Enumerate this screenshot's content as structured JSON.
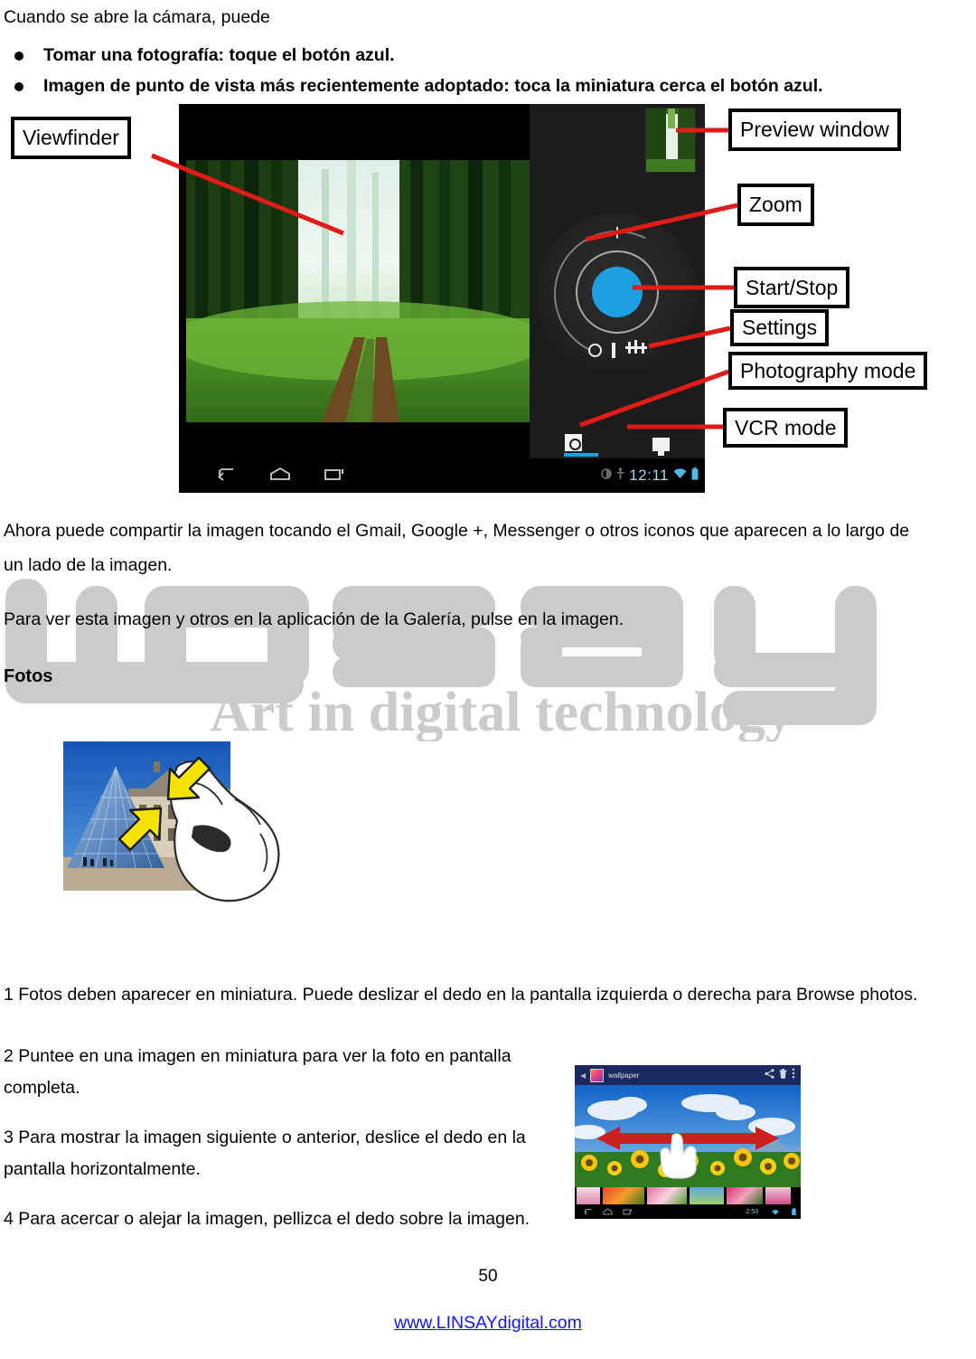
{
  "intro": {
    "line": "Cuando se abre la cámara, puede"
  },
  "bullets": [
    {
      "text": "Tomar una fotografía: toque el botón azul."
    },
    {
      "text": "Imagen de punto de vista más recientemente adoptado: toca la miniatura cerca el botón azul."
    }
  ],
  "camera_figure": {
    "callouts": {
      "viewfinder": "Viewfinder",
      "preview_window": "Preview window",
      "zoom": "Zoom",
      "start_stop": "Start/Stop",
      "settings": "Settings",
      "photography_mode": "Photography mode",
      "vcr_mode": "VCR mode"
    },
    "status_bar": {
      "clock": "12:11"
    },
    "zoom_plus": "+",
    "colors": {
      "shutter_blue": "#1e9fe0",
      "leader_red": "#e01b18",
      "panel_dark": "#1c1c1c",
      "device_black": "#000000"
    }
  },
  "paragraphs": {
    "share_line1": "Ahora puede compartir la imagen tocando el Gmail, Google +, Messenger o otros iconos que aparecen a lo largo de",
    "share_line2": "un lado de la imagen.",
    "gallery_view": "Para ver esta imagen y otros en la aplicación de la Galería, pulse en la imagen."
  },
  "heading": {
    "fotos": "Fotos"
  },
  "watermark": {
    "brand": "LINSAY",
    "tagline": "Art in digital technology",
    "color": "#cbcbcb"
  },
  "steps": {
    "step1": "1 Fotos deben aparecer en miniatura. Puede deslizar el dedo en la pantalla izquierda o derecha para Browse photos.",
    "step2_line1": "2 Puntee en una imagen en miniatura para ver la foto en pantalla",
    "step2_line2": "completa.",
    "step3_line1": " 3 Para mostrar la imagen siguiente o anterior, deslice el dedo en la",
    "step3_line2": "pantalla horizontalmente.",
    "step4": "4 Para acercar o alejar la imagen, pellizca el dedo sobre la imagen."
  },
  "gallery_figure": {
    "title": "wallpaper",
    "icons": [
      "share-icon",
      "delete-icon",
      "overflow-menu-icon"
    ],
    "gesture": "horizontal-swipe-arrow",
    "arrow_color": "#cc1f1f"
  },
  "louvre_figure": {
    "gesture": "pinch-zoom",
    "arrow_color": "#f5e400"
  },
  "footer": {
    "page_number": "50",
    "url": "www.LINSAYdigital.com"
  }
}
